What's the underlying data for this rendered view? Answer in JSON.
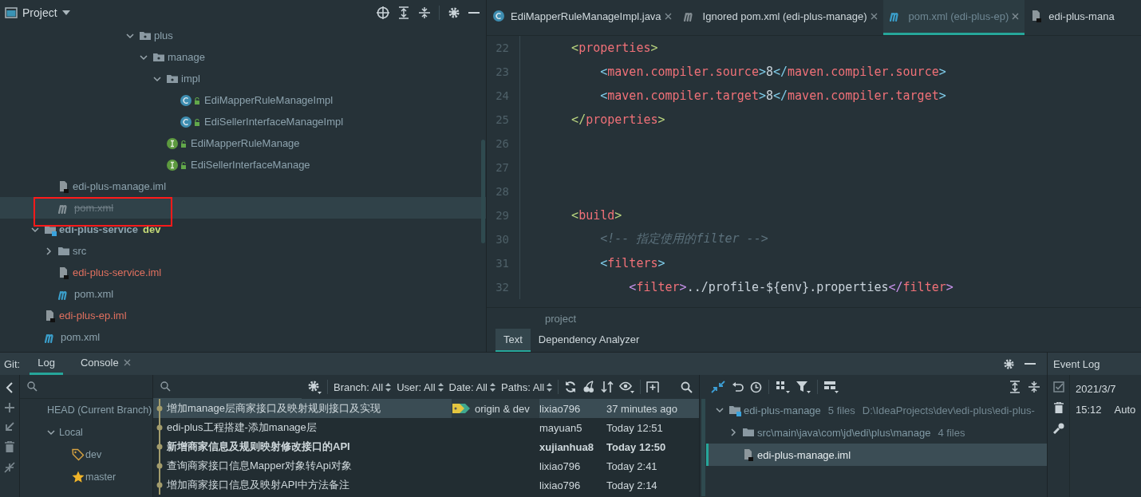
{
  "project": {
    "title": "Project",
    "annotation_frame": true,
    "tree": [
      {
        "label": "plus",
        "kind": "package",
        "ignored": false,
        "unversioned": false,
        "selected": false,
        "expanded": true,
        "children": [
          {
            "label": "manage",
            "kind": "package",
            "ignored": false,
            "unversioned": false,
            "selected": false,
            "expanded": true,
            "children": [
              {
                "label": "impl",
                "kind": "package",
                "ignored": false,
                "unversioned": false,
                "selected": false,
                "expanded": true,
                "children": [
                  {
                    "label": "EdiMapperRuleManageImpl",
                    "kind": "class",
                    "ignored": false,
                    "unversioned": false,
                    "selected": false
                  },
                  {
                    "label": "EdiSellerInterfaceManageImpl",
                    "kind": "class",
                    "ignored": false,
                    "unversioned": false,
                    "selected": false
                  }
                ]
              },
              {
                "label": "EdiMapperRuleManage",
                "kind": "interface",
                "ignored": false,
                "unversioned": false,
                "selected": false
              },
              {
                "label": "EdiSellerInterfaceManage",
                "kind": "interface",
                "ignored": false,
                "unversioned": false,
                "selected": false
              }
            ]
          }
        ]
      },
      {
        "label": "edi-plus-manage.iml",
        "kind": "iml",
        "ignored": false,
        "unversioned": false,
        "selected": false
      },
      {
        "label": "pom.xml",
        "kind": "maven",
        "ignored": true,
        "unversioned": false,
        "selected": true
      },
      {
        "label": "edi-plus-service",
        "kind": "module",
        "ignored": false,
        "unversioned": false,
        "branch": "dev",
        "selected": false,
        "expanded": true,
        "children": [
          {
            "label": "src",
            "kind": "folder",
            "ignored": false,
            "unversioned": false,
            "selected": false,
            "expanded": false
          },
          {
            "label": "edi-plus-service.iml",
            "kind": "iml",
            "ignored": false,
            "unversioned": true,
            "selected": false
          },
          {
            "label": "pom.xml",
            "kind": "maven",
            "ignored": false,
            "unversioned": false,
            "selected": false
          }
        ]
      },
      {
        "label": "edi-plus-ep.iml",
        "kind": "iml",
        "ignored": false,
        "unversioned": true,
        "selected": false
      },
      {
        "label": "pom.xml",
        "kind": "maven",
        "ignored": false,
        "unversioned": false,
        "selected": false
      }
    ]
  },
  "editor": {
    "tabs": [
      {
        "label": "EdiMapperRuleManageImpl.java",
        "kind": "class",
        "ignored": false,
        "selected": false,
        "closable": true
      },
      {
        "label": "Ignored pom.xml (edi-plus-manage)",
        "kind": "maven",
        "ignored": true,
        "selected": false,
        "closable": true
      },
      {
        "label": "pom.xml (edi-plus-ep)",
        "kind": "maven",
        "ignored": false,
        "selected": true,
        "closable": true
      },
      {
        "label": "edi-plus-mana",
        "kind": "iml",
        "ignored": false,
        "selected": false,
        "closable": false
      }
    ],
    "lines": [
      {
        "number": "22",
        "tokens": [
          {
            "t": "    <",
            "kind": "b1"
          },
          {
            "t": "properties",
            "kind": "tag"
          },
          {
            "t": ">",
            "kind": "b1"
          }
        ]
      },
      {
        "number": "23",
        "tokens": [
          {
            "t": "        <",
            "kind": "b2"
          },
          {
            "t": "maven.compiler.source",
            "kind": "tag"
          },
          {
            "t": ">",
            "kind": "b2"
          },
          {
            "t": "8",
            "kind": "text"
          },
          {
            "t": "</",
            "kind": "b2"
          },
          {
            "t": "maven.compiler.source",
            "kind": "tag"
          },
          {
            "t": ">",
            "kind": "b2"
          }
        ]
      },
      {
        "number": "24",
        "tokens": [
          {
            "t": "        <",
            "kind": "b2"
          },
          {
            "t": "maven.compiler.target",
            "kind": "tag"
          },
          {
            "t": ">",
            "kind": "b2"
          },
          {
            "t": "8",
            "kind": "text"
          },
          {
            "t": "</",
            "kind": "b2"
          },
          {
            "t": "maven.compiler.target",
            "kind": "tag"
          },
          {
            "t": ">",
            "kind": "b2"
          }
        ]
      },
      {
        "number": "25",
        "tokens": [
          {
            "t": "    </",
            "kind": "b1"
          },
          {
            "t": "properties",
            "kind": "tag"
          },
          {
            "t": ">",
            "kind": "b1"
          }
        ]
      },
      {
        "number": "26"
      },
      {
        "number": "27"
      },
      {
        "number": "28"
      },
      {
        "number": "29",
        "tokens": [
          {
            "t": "    <",
            "kind": "b1"
          },
          {
            "t": "build",
            "kind": "tag"
          },
          {
            "t": ">",
            "kind": "b1"
          }
        ]
      },
      {
        "number": "30",
        "tokens": [
          {
            "t": "        <!-- 指定使用的filter -->",
            "kind": "comment"
          }
        ]
      },
      {
        "number": "31",
        "tokens": [
          {
            "t": "        <",
            "kind": "b2"
          },
          {
            "t": "filters",
            "kind": "tag"
          },
          {
            "t": ">",
            "kind": "b2"
          }
        ]
      },
      {
        "number": "32",
        "tokens": [
          {
            "t": "            <",
            "kind": "b3"
          },
          {
            "t": "filter",
            "kind": "tag"
          },
          {
            "t": ">",
            "kind": "b3"
          },
          {
            "t": "../profile-${env}.properties",
            "kind": "text"
          },
          {
            "t": "</",
            "kind": "b3"
          },
          {
            "t": "filter",
            "kind": "tag"
          },
          {
            "t": ">",
            "kind": "b3"
          }
        ]
      }
    ],
    "breadcrumb": "project",
    "view_tabs": [
      {
        "label": "Text",
        "selected": true
      },
      {
        "label": "Dependency Analyzer",
        "selected": false
      }
    ]
  },
  "git": {
    "title": "Git:",
    "tabs": [
      {
        "label": "Log",
        "selected": true,
        "closable": false
      },
      {
        "label": "Console",
        "selected": false,
        "closable": true
      }
    ],
    "branches": [
      {
        "label": "HEAD (Current Branch)"
      },
      {
        "label": "Local",
        "expanded": true,
        "children": [
          {
            "label": "dev",
            "favorite": false
          },
          {
            "label": "master",
            "favorite": true
          }
        ]
      }
    ],
    "filters": [
      "Branch: All",
      "User: All",
      "Date: All",
      "Paths: All"
    ],
    "commits": [
      {
        "message": "增加manage层商家接口及映射规则接口及实现",
        "refs": "origin & dev",
        "author": "lixiao796",
        "date": "37 minutes ago",
        "selected": true,
        "bold": false
      },
      {
        "message": "edi-plus工程搭建-添加manage层",
        "author": "mayuan5",
        "date": "Today 12:51",
        "selected": false,
        "bold": false
      },
      {
        "message": "新增商家信息及规则映射修改接口的API",
        "author": "xujianhua8",
        "date": "Today 12:50",
        "selected": false,
        "bold": true
      },
      {
        "message": "查询商家接口信息Mapper对象转Api对象",
        "author": "lixiao796",
        "date": "Today 2:41",
        "selected": false,
        "bold": false
      },
      {
        "message": "增加商家接口信息及映射API中方法备注",
        "author": "lixiao796",
        "date": "Today 2:14",
        "selected": false,
        "bold": false
      }
    ],
    "changes": [
      {
        "label": "edi-plus-manage",
        "kind": "module",
        "count": "5 files",
        "path": "D:\\IdeaProjects\\dev\\edi-plus\\edi-plus-",
        "selected": false,
        "expanded": true,
        "children": [
          {
            "label": "src\\main\\java\\com\\jd\\edi\\plus\\manage",
            "kind": "folder",
            "count": "4 files",
            "selected": false,
            "expanded": false
          },
          {
            "label": "edi-plus-manage.iml",
            "kind": "iml",
            "selected": true
          }
        ]
      }
    ]
  },
  "event_log": {
    "title": "Event Log",
    "entries": [
      {
        "date": "2021/3/7",
        "time": "15:12",
        "text": "Auto"
      }
    ]
  }
}
